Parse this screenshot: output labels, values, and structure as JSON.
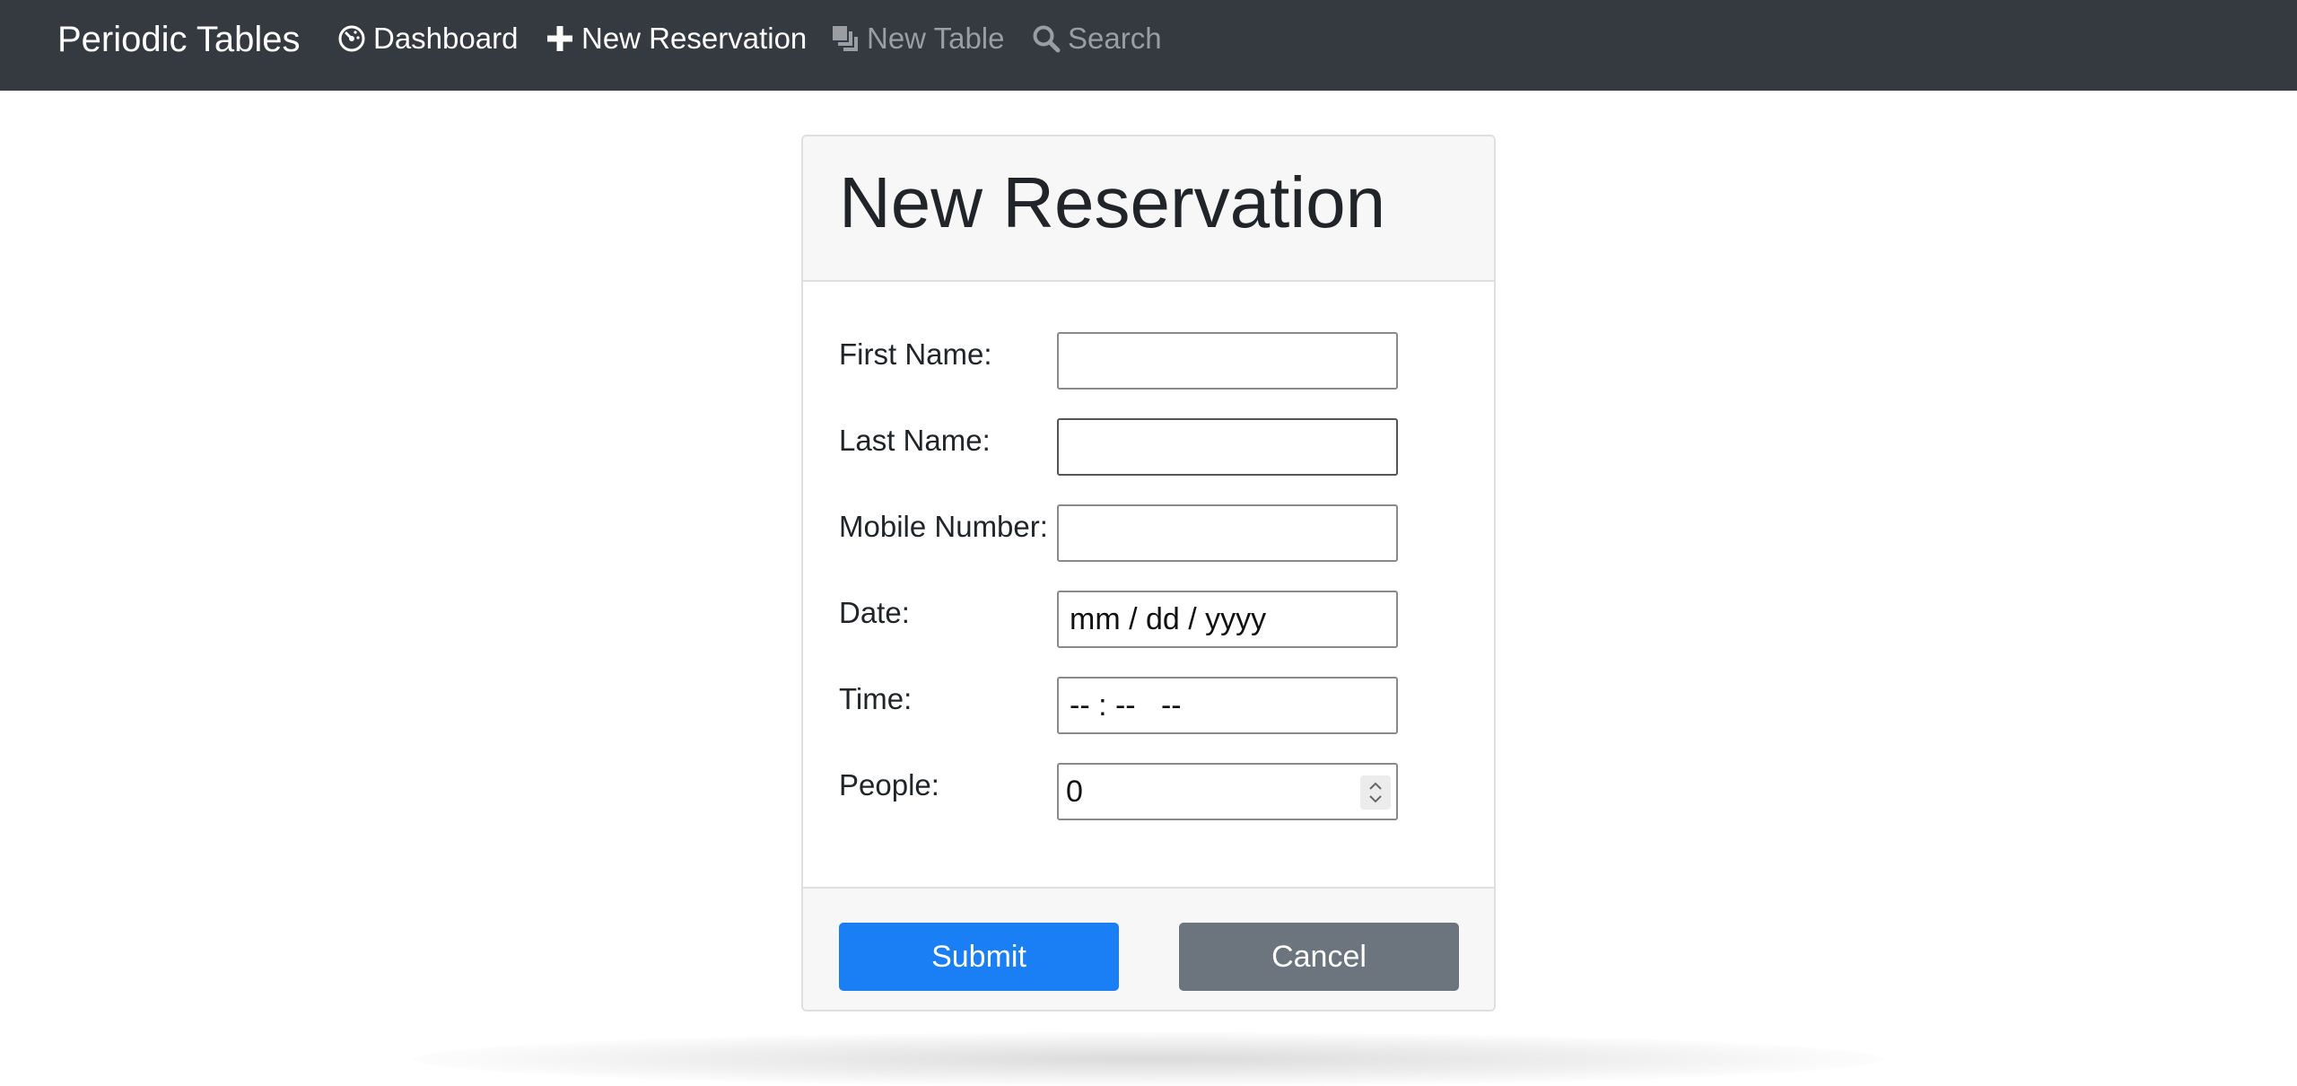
{
  "navbar": {
    "brand": "Periodic Tables",
    "links": [
      {
        "label": "Dashboard",
        "icon": "dashboard-gauge-icon",
        "state": "active"
      },
      {
        "label": "New Reservation",
        "icon": "plus-icon",
        "state": "active"
      },
      {
        "label": "New Table",
        "icon": "layers-icon",
        "state": "muted"
      },
      {
        "label": "Search",
        "icon": "search-icon",
        "state": "muted"
      }
    ]
  },
  "form": {
    "title": "New Reservation",
    "fields": {
      "first_name": {
        "label": "First Name:",
        "value": ""
      },
      "last_name": {
        "label": "Last Name:",
        "value": ""
      },
      "mobile_number": {
        "label": "Mobile Number:",
        "value": ""
      },
      "date": {
        "label": "Date:",
        "display": "mm / dd / yyyy"
      },
      "time": {
        "label": "Time:",
        "display": "-- : --   --"
      },
      "people": {
        "label": "People:",
        "value": "0"
      }
    },
    "submit_label": "Submit",
    "cancel_label": "Cancel"
  },
  "colors": {
    "navbar_bg": "#343a40",
    "primary": "#1a7ef5",
    "secondary": "#6c757d"
  }
}
